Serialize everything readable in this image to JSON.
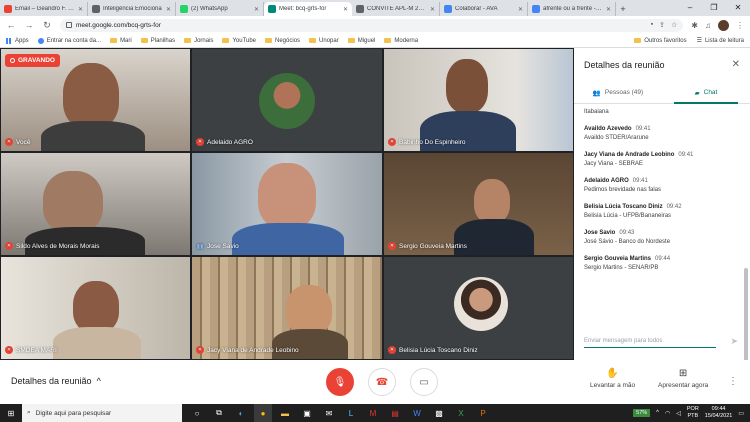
{
  "browser": {
    "tabs": [
      {
        "title": "Email – Geandro F. Fer",
        "color": "#ea4335"
      },
      {
        "title": "Inteligência Emociona",
        "color": "#5f6368"
      },
      {
        "title": "(2) WhatsApp",
        "color": "#25d366"
      },
      {
        "title": "Meet: bcq-grts-for",
        "color": "#00897b",
        "active": true
      },
      {
        "title": "CONVITE APL-M 2021",
        "color": "#5f6368"
      },
      {
        "title": "Colaborar - AVA",
        "color": "#4285f4"
      },
      {
        "title": "afrente ou a frente - Pe",
        "color": "#4285f4"
      }
    ],
    "new_tab": "+",
    "url": "meet.google.com/bcq-grts-for"
  },
  "bookmarks": {
    "items": [
      "Apps",
      "Entrar na conta da...",
      "Mari",
      "Planilhas",
      "Jornais",
      "YouTube",
      "Negócios",
      "Unopar",
      "Miguel",
      "Moderna"
    ],
    "right": [
      "Outros favoritos",
      "Lista de leitura"
    ]
  },
  "meet": {
    "recording_label": "GRAVANDO",
    "participants": [
      {
        "name": "Você",
        "muted": true,
        "bg": "#7a6f67"
      },
      {
        "name": "Adelaido AGRO",
        "muted": true,
        "bg": "#3c4043"
      },
      {
        "name": "Babinho Do Espinheiro",
        "muted": true,
        "bg": "#c9c4bb"
      },
      {
        "name": "Sildo Alves de Morais Morais",
        "muted": true,
        "bg": "#8d8a86"
      },
      {
        "name": "Jose Savio",
        "muted": false,
        "bg": "#6b7c8c"
      },
      {
        "name": "Sergio Gouveia Martins",
        "muted": true,
        "bg": "#6e5a45"
      },
      {
        "name": "SMDEA MARI",
        "muted": true,
        "bg": "#a8a39a"
      },
      {
        "name": "Jacy Viana de Andrade Leobino",
        "muted": true,
        "bg": "#b89f80"
      },
      {
        "name": "Belisia Lúcia Toscano Diniz",
        "muted": true,
        "bg": "#3c4043"
      }
    ],
    "panel": {
      "title": "Detalhes da reunião",
      "tabs": [
        {
          "label": "Pessoas (49)",
          "active": false
        },
        {
          "label": "Chat",
          "active": true
        }
      ],
      "first_text": "Itabaiana",
      "messages": [
        {
          "sender": "Availdo Azevedo",
          "time": "09:41",
          "text": "Availdo STDER/Ararune"
        },
        {
          "sender": "Jacy Viana de Andrade Leobino",
          "time": "09:41",
          "text": "Jacy Viana - SEBRAE"
        },
        {
          "sender": "Adelaido AGRO",
          "time": "09:41",
          "text": "Pedimos brevidade nas falas"
        },
        {
          "sender": "Belisia Lúcia Toscano Diniz",
          "time": "09:42",
          "text": "Belisia Lúcia - UFPB/Bananeiras"
        },
        {
          "sender": "Jose Savio",
          "time": "09:43",
          "text": "José Sávio - Banco do Nordeste"
        },
        {
          "sender": "Sergio Gouveia Martins",
          "time": "09:44",
          "text": "Sergio Martins - SENAR/PB"
        }
      ],
      "compose_placeholder": "Enviar mensagem para todos"
    },
    "bottom": {
      "details_label": "Detalhes da reunião",
      "raise_hand": "Levantar a mão",
      "present_now": "Apresentar agora"
    }
  },
  "taskbar": {
    "search_placeholder": "Digite aqui para pesquisar",
    "battery": "57%",
    "language": "POR",
    "layout": "PTB",
    "time": "09:44",
    "date": "15/04/2021"
  }
}
